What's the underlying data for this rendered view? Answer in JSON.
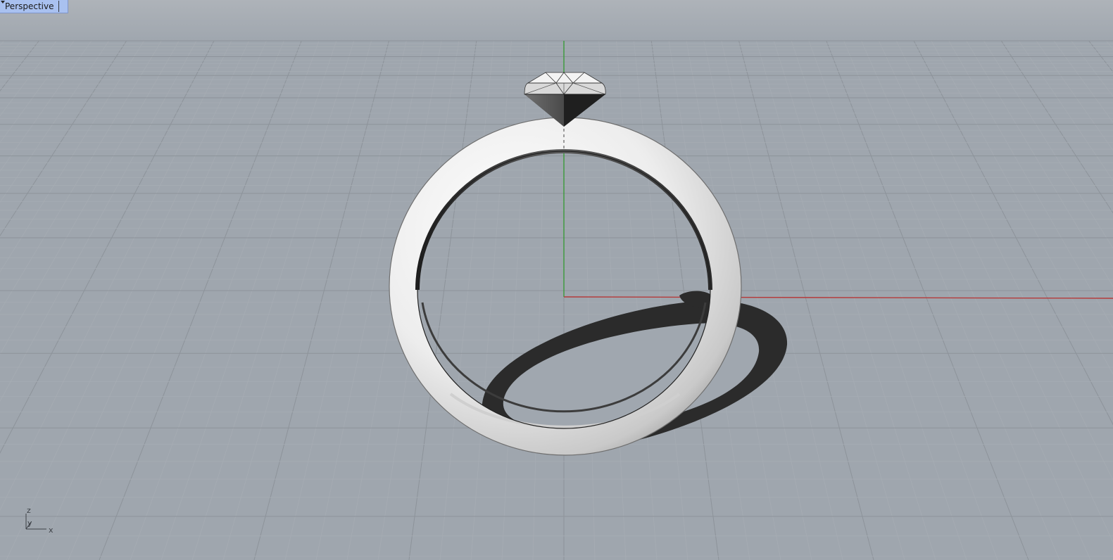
{
  "viewport": {
    "name": "Perspective",
    "menu_icon": "chevron-down-icon",
    "colors": {
      "background": "#9fa6ae",
      "horizon_haze": "#b2b7bd",
      "grid_minor": "#a6acb3",
      "grid_major": "#8d939a",
      "x_axis": "#b53a3a",
      "y_axis": "#3a9a3a",
      "tab_highlight": "#a9c1f0"
    }
  },
  "axis_indicator": {
    "z_label": "z",
    "y_label": "y",
    "x_label": "x"
  },
  "scene": {
    "objects": [
      "ring-band",
      "gemstone",
      "shadow"
    ]
  }
}
